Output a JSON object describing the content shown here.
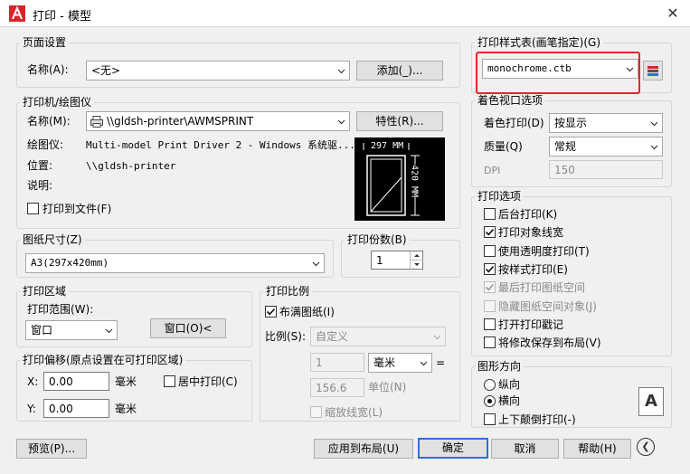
{
  "window": {
    "title": "打印 - 模型",
    "close_glyph": "✕"
  },
  "page_setup": {
    "title": "页面设置",
    "name_label": "名称(A):",
    "name_value": "<无>",
    "add_button": "添加(_)..."
  },
  "printer": {
    "title": "打印机/绘图仪",
    "name_label": "名称(M):",
    "name_value": "\\\\gldsh-printer\\AWMSPRINT",
    "properties_button": "特性(R)...",
    "plotter_label": "绘图仪:",
    "plotter_value": "Multi-model Print Driver 2 - Windows 系统驱...",
    "location_label": "位置:",
    "location_value": "\\\\gldsh-printer",
    "description_label": "说明:",
    "print_to_file": "打印到文件(F)",
    "preview_width": "297 MM",
    "preview_height": "420 MM"
  },
  "paper": {
    "title": "图纸尺寸(Z)",
    "value": "A3(297x420mm)"
  },
  "copies": {
    "title": "打印份数(B)",
    "value": "1"
  },
  "area": {
    "title": "打印区域",
    "range_label": "打印范围(W):",
    "range_value": "窗口",
    "window_button": "窗口(O)<"
  },
  "offset": {
    "title": "打印偏移(原点设置在可打印区域)",
    "x_label": "X:",
    "x_value": "0.00",
    "x_unit": "毫米",
    "y_label": "Y:",
    "y_value": "0.00",
    "y_unit": "毫米",
    "center": "居中打印(C)"
  },
  "scale": {
    "title": "打印比例",
    "fit": "布满图纸(I)",
    "ratio_label": "比例(S):",
    "ratio_value": "自定义",
    "val1": "1",
    "unit1": "毫米",
    "equals": "=",
    "val2": "156.6",
    "unit2": "单位(N)",
    "lineweights": "缩放线宽(L)"
  },
  "style_table": {
    "title": "打印样式表(画笔指定)(G)",
    "value": "monochrome.ctb"
  },
  "shaded": {
    "title": "着色视口选项",
    "shade_label": "着色打印(D)",
    "shade_value": "按显示",
    "quality_label": "质量(Q)",
    "quality_value": "常规",
    "dpi_label": "DPI",
    "dpi_value": "150"
  },
  "options": {
    "title": "打印选项",
    "items": [
      {
        "label": "后台打印(K)",
        "checked": false,
        "disabled": false
      },
      {
        "label": "打印对象线宽",
        "checked": true,
        "disabled": false
      },
      {
        "label": "使用透明度打印(T)",
        "checked": false,
        "disabled": false
      },
      {
        "label": "按样式打印(E)",
        "checked": true,
        "disabled": false
      },
      {
        "label": "最后打印图纸空间",
        "checked": true,
        "disabled": true
      },
      {
        "label": "隐藏图纸空间对象(J)",
        "checked": false,
        "disabled": true
      },
      {
        "label": "打开打印戳记",
        "checked": false,
        "disabled": false
      },
      {
        "label": "将修改保存到布局(V)",
        "checked": false,
        "disabled": false
      }
    ]
  },
  "orientation": {
    "title": "图形方向",
    "portrait": "纵向",
    "landscape": "横向",
    "upside_down": "上下颠倒打印(-)",
    "icon_letter": "A"
  },
  "bottom": {
    "preview": "预览(P)...",
    "apply": "应用到布局(U)",
    "ok": "确定",
    "cancel": "取消",
    "help": "帮助(H)",
    "more_glyph": "❮"
  },
  "colors": {
    "highlight": "#e8242b",
    "default_button_border": "#2f6fd6",
    "autocad_red": "#d7262b"
  }
}
